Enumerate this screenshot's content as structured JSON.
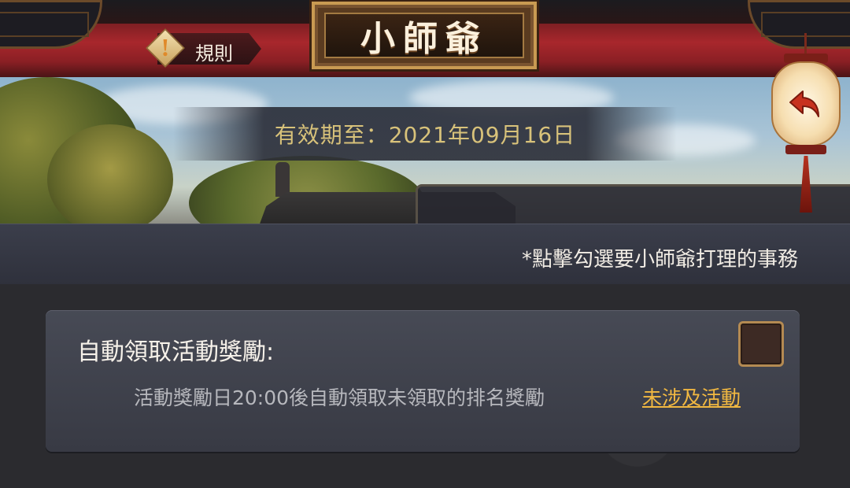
{
  "header": {
    "title": "小師爺",
    "rules_label": "規則",
    "rules_icon": "exclamation-icon",
    "back_icon": "back-arrow-icon"
  },
  "validity": {
    "text": "有效期至：2021年09月16日"
  },
  "hint": {
    "text": "*點擊勾選要小師爺打理的事務"
  },
  "task": {
    "title": "自動領取活動獎勵:",
    "description": "活動獎勵日20:00後自動領取未領取的排名獎勵",
    "link": "未涉及活動",
    "checked": false
  },
  "colors": {
    "accent_gold": "#f1b841",
    "validity_text": "#d8c27a",
    "banner_red": "#a8272c"
  }
}
